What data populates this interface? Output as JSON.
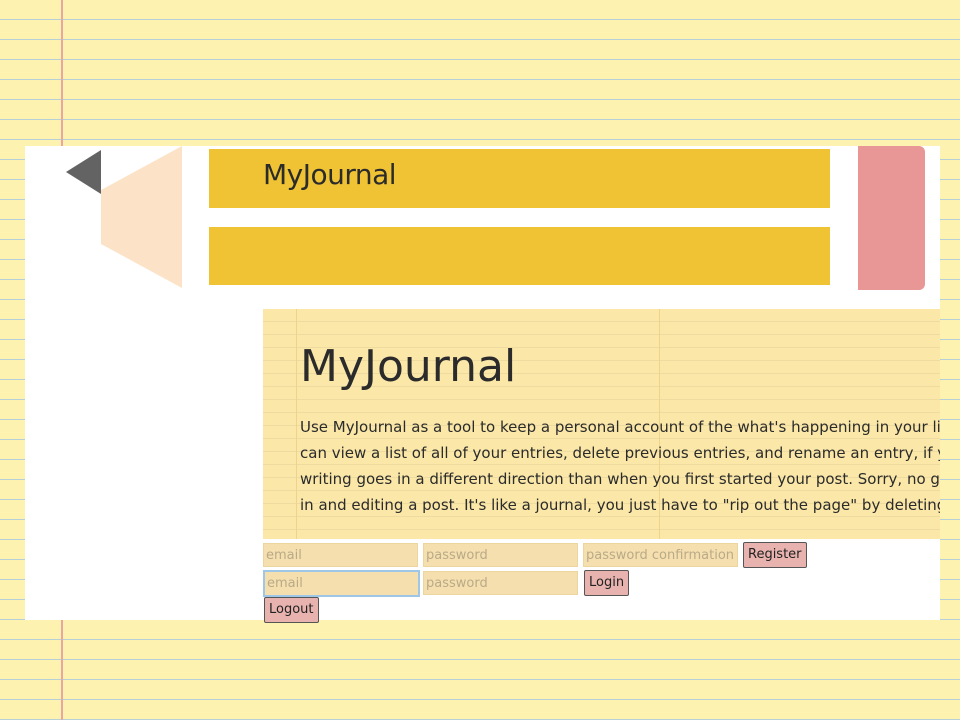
{
  "header": {
    "brand": "MyJournal"
  },
  "intro": {
    "title": "MyJournal",
    "description": "Use MyJournal as a tool to keep a personal account of the what's happening in your life. You can view a list of all of your entries, delete previous entries, and rename an entry, if your writing goes in a different direction than when you first started your post. Sorry, no going back in and editing a post. It's like a journal, you just have to \"rip out the page\" by deleting it."
  },
  "register_form": {
    "email_placeholder": "email",
    "password_placeholder": "password",
    "password_confirmation_placeholder": "password confirmation",
    "submit_label": "Register"
  },
  "login_form": {
    "email_placeholder": "email",
    "password_placeholder": "password",
    "submit_label": "Login"
  },
  "logout": {
    "label": "Logout"
  },
  "colors": {
    "background_paper": "#fdf2b0",
    "pencil_yellow": "#f0c334",
    "eraser_pink": "#e89696",
    "button_pink": "#e8b3ae",
    "input_tan": "#f6dfae"
  }
}
